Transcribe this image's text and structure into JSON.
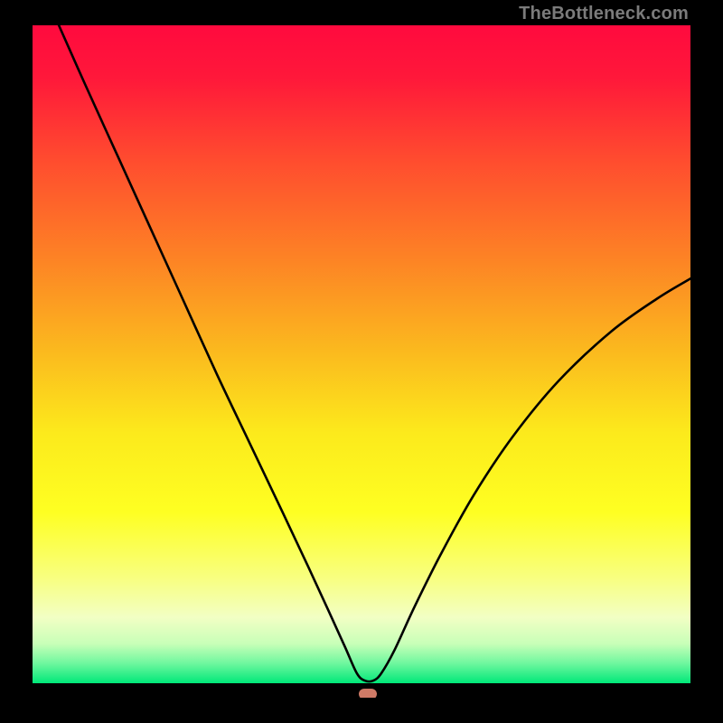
{
  "watermark": {
    "text": "TheBottleneck.com"
  },
  "chart_data": {
    "type": "line",
    "title": "",
    "xlabel": "",
    "ylabel": "",
    "xlim": [
      0,
      100
    ],
    "ylim": [
      0,
      100
    ],
    "grid": false,
    "legend": false,
    "annotations": [],
    "background_gradient": {
      "stops": [
        {
          "pos": 0.0,
          "color": "#ff0a3e"
        },
        {
          "pos": 0.08,
          "color": "#ff183a"
        },
        {
          "pos": 0.2,
          "color": "#ff4a2f"
        },
        {
          "pos": 0.35,
          "color": "#fd8125"
        },
        {
          "pos": 0.5,
          "color": "#fbbb1e"
        },
        {
          "pos": 0.62,
          "color": "#fcea1c"
        },
        {
          "pos": 0.74,
          "color": "#feff22"
        },
        {
          "pos": 0.84,
          "color": "#f8ff80"
        },
        {
          "pos": 0.9,
          "color": "#f2ffc4"
        },
        {
          "pos": 0.94,
          "color": "#c8ffb8"
        },
        {
          "pos": 0.97,
          "color": "#6ef79e"
        },
        {
          "pos": 1.0,
          "color": "#00e879"
        }
      ]
    },
    "series": [
      {
        "name": "bottleneck-curve",
        "color": "#000000",
        "stroke_width": 2.6,
        "points": [
          {
            "x": 4.0,
            "y": 100.0
          },
          {
            "x": 8.0,
            "y": 91.0
          },
          {
            "x": 13.0,
            "y": 80.0
          },
          {
            "x": 18.0,
            "y": 69.0
          },
          {
            "x": 23.0,
            "y": 58.0
          },
          {
            "x": 28.0,
            "y": 47.0
          },
          {
            "x": 33.0,
            "y": 36.5
          },
          {
            "x": 38.0,
            "y": 26.0
          },
          {
            "x": 42.0,
            "y": 17.5
          },
          {
            "x": 45.0,
            "y": 11.0
          },
          {
            "x": 47.5,
            "y": 5.5
          },
          {
            "x": 49.3,
            "y": 1.5
          },
          {
            "x": 50.5,
            "y": 0.4
          },
          {
            "x": 51.8,
            "y": 0.4
          },
          {
            "x": 53.0,
            "y": 1.5
          },
          {
            "x": 55.0,
            "y": 5.0
          },
          {
            "x": 58.0,
            "y": 11.5
          },
          {
            "x": 62.0,
            "y": 19.5
          },
          {
            "x": 67.0,
            "y": 28.5
          },
          {
            "x": 73.0,
            "y": 37.5
          },
          {
            "x": 80.0,
            "y": 46.0
          },
          {
            "x": 88.0,
            "y": 53.5
          },
          {
            "x": 95.0,
            "y": 58.5
          },
          {
            "x": 100.0,
            "y": 61.5
          }
        ]
      }
    ],
    "marker": {
      "name": "optimal-point",
      "x": 51.0,
      "y": 0.6,
      "color": "#cf7a66"
    }
  }
}
